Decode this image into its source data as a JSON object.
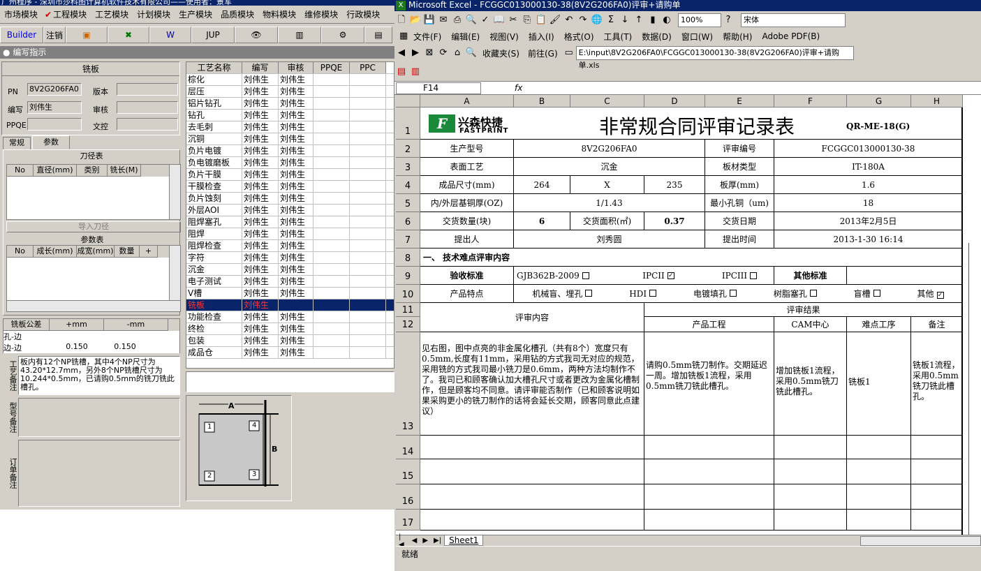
{
  "left_app": {
    "title": "广州程序 - 深圳市莎科图计算机软件技术有限公司——使用者：景军",
    "menu": [
      "市场模块",
      "工程模块",
      "工艺模块",
      "计划模块",
      "生产模块",
      "品质模块",
      "物料模块",
      "维修模块",
      "行政模块"
    ],
    "toolbar": [
      "Builder",
      "注销",
      "",
      "",
      "W",
      "JUP",
      "",
      "",
      "",
      ""
    ],
    "subtitle": "编写指示",
    "panel_title": "铣板",
    "fields": {
      "pn_label": "PN",
      "pn_value": "8V2G206FA0",
      "version_label": "版本",
      "writer_label": "编写",
      "writer_value": "刘伟生",
      "review_label": "审核",
      "ppqe_label": "PPQE",
      "doc_label": "文控"
    },
    "tabs": [
      "常规",
      "参数"
    ],
    "cutter_table_title": "刀径表",
    "cutter_cols": [
      "No",
      "直径(mm)",
      "类别",
      "铣长(M)"
    ],
    "import_button": "导入刀径",
    "param_table_title": "参数表",
    "param_cols": [
      "No",
      "成长(mm)",
      "成宽(mm)",
      "数量",
      "+"
    ],
    "tol_cols": [
      "铣板公差",
      "+mm",
      "-mm"
    ],
    "tol_rows": [
      [
        "孔-边",
        "",
        ""
      ],
      [
        "边-边",
        "0.150",
        "0.150"
      ]
    ],
    "process_note_label": "工艺备注",
    "process_note": "板内有12个NP铣槽，其中4个NP尺寸为43.20*12.7mm，另外8个NP铣槽尺寸为10.244*0.5mm，已请购0.5mm的铣刀铣此槽孔。",
    "model_note_label": "型号备注",
    "order_note_label": "订单备注",
    "process_cols": [
      "工艺名称",
      "编写",
      "审核",
      "PPQE",
      "PPC"
    ],
    "process_rows": [
      [
        "棕化",
        "刘伟生",
        "刘伟生"
      ],
      [
        "层压",
        "刘伟生",
        "刘伟生"
      ],
      [
        "铝片钻孔",
        "刘伟生",
        "刘伟生"
      ],
      [
        "钻孔",
        "刘伟生",
        "刘伟生"
      ],
      [
        "去毛刺",
        "刘伟生",
        "刘伟生"
      ],
      [
        "沉铜",
        "刘伟生",
        "刘伟生"
      ],
      [
        "负片电镀",
        "刘伟生",
        "刘伟生"
      ],
      [
        "负电镀磨板",
        "刘伟生",
        "刘伟生"
      ],
      [
        "负片干膜",
        "刘伟生",
        "刘伟生"
      ],
      [
        "干膜检查",
        "刘伟生",
        "刘伟生"
      ],
      [
        "负片蚀刻",
        "刘伟生",
        "刘伟生"
      ],
      [
        "外层AOI",
        "刘伟生",
        "刘伟生"
      ],
      [
        "阻焊塞孔",
        "刘伟生",
        "刘伟生"
      ],
      [
        "阻焊",
        "刘伟生",
        "刘伟生"
      ],
      [
        "阻焊检查",
        "刘伟生",
        "刘伟生"
      ],
      [
        "字符",
        "刘伟生",
        "刘伟生"
      ],
      [
        "沉金",
        "刘伟生",
        "刘伟生"
      ],
      [
        "电子测试",
        "刘伟生",
        "刘伟生"
      ],
      [
        "V槽",
        "刘伟生",
        "刘伟生"
      ],
      [
        "铣板",
        "刘伟生",
        ""
      ],
      [
        "功能检查",
        "刘伟生",
        "刘伟生"
      ],
      [
        "终检",
        "刘伟生",
        "刘伟生"
      ],
      [
        "包装",
        "刘伟生",
        "刘伟生"
      ],
      [
        "成品仓",
        "刘伟生",
        "刘伟生"
      ]
    ],
    "diagram": {
      "a": "A",
      "b": "B",
      "n1": "1",
      "n2": "2",
      "n3": "3",
      "n4": "4"
    }
  },
  "excel": {
    "title": "Microsoft Excel - FCGGC013000130-38(8V2G206FA0)评审+请购单",
    "zoom": "100%",
    "font": "宋体",
    "menu": [
      "文件(F)",
      "编辑(E)",
      "视图(V)",
      "插入(I)",
      "格式(O)",
      "工具(T)",
      "数据(D)",
      "窗口(W)",
      "帮助(H)",
      "Adobe PDF(B)"
    ],
    "favorites": "收藏夹(S)",
    "goto": "前往(G)",
    "path": "E:\\input\\8V2G206FA0\\FCGGC013000130-38(8V2G206FA0)评审+请购单.xls",
    "namebox": "F14",
    "fx": "fx",
    "cols": [
      "A",
      "B",
      "C",
      "D",
      "E",
      "F",
      "G",
      "H"
    ],
    "rows": [
      "1",
      "2",
      "3",
      "4",
      "5",
      "6",
      "7",
      "8",
      "9",
      "10",
      "11",
      "12",
      "13",
      "14",
      "15",
      "16",
      "17"
    ],
    "logo_cn": "兴森快捷",
    "logo_en": "FASTPRINT",
    "sheet_title": "非常规合同评审记录表",
    "form_code": "QR-ME-18(G)",
    "r2": [
      "生产型号",
      "8V2G206FA0",
      "评审编号",
      "FCGGC013000130-38"
    ],
    "r3": [
      "表面工艺",
      "沉金",
      "板材类型",
      "IT-180A"
    ],
    "r4": [
      "成品尺寸(mm)",
      "264",
      "X",
      "235",
      "板厚(mm)",
      "1.6"
    ],
    "r5": [
      "内/外层基铜厚(OZ)",
      "1/1.43",
      "最小孔铜（um)",
      "18"
    ],
    "r6": [
      "交货数量(块)",
      "6",
      "交货面积(㎡)",
      "0.37",
      "交货日期",
      "2013年2月5日"
    ],
    "r7": [
      "提出人",
      "刘秀圆",
      "提出时间",
      "2013-1-30 16:14"
    ],
    "r8": "一、 技术难点评审内容",
    "r9": [
      "验收标准",
      "GJB362B-2009",
      "IPCII",
      "IPCIII",
      "其他标准"
    ],
    "r10": [
      "产品特点",
      "机械盲、埋孔",
      "HDI",
      "电镀填孔",
      "树脂塞孔",
      "盲槽",
      "其他"
    ],
    "r11": [
      "评审内容",
      "评审结果"
    ],
    "r12": [
      "产品工程",
      "CAM中心",
      "难点工序",
      "备注"
    ],
    "r13": [
      "见右图，图中点亮的非金属化槽孔（共有8个）宽度只有0.5mm,长度有11mm，采用钻的方式我司无对应的规范，采用铣的方式我司最小铣刀是0.6mm，两种方法均制作不了。我司已和顾客确认加大槽孔尺寸或者更改为金属化槽制作，但是顾客均不同意。请评审能否制作（已和顾客说明如果采购更小的铣刀制作的话将会延长交期，顾客同意此点建议）",
      "请购0.5mm铣刀制作。交期延迟一周。增加铣板1流程，采用0.5mm铣刀铣此槽孔。",
      "增加铣板1流程，采用0.5mm铣刀铣此槽孔。",
      "铣板1",
      "铣板1流程，采用0.5mm铣刀铣此槽孔。"
    ],
    "sheet_tab": "Sheet1",
    "status": "就绪"
  }
}
